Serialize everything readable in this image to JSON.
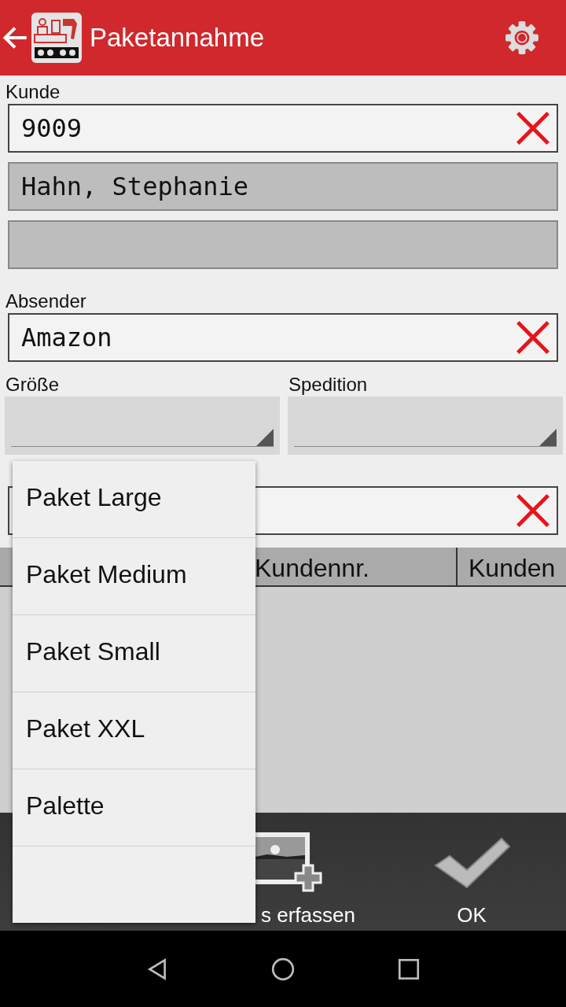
{
  "app_bar": {
    "title": "Paketannahme"
  },
  "customer": {
    "label": "Kunde",
    "number": "9009",
    "name": "Hahn, Stephanie"
  },
  "sender": {
    "label": "Absender",
    "value": "Amazon"
  },
  "size": {
    "label": "Größe"
  },
  "carrier": {
    "label": "Spedition"
  },
  "table": {
    "columns": [
      "",
      "Kundennr.",
      "Kunden"
    ]
  },
  "actions": [
    {
      "label": "s erfassen",
      "kind": "photos"
    },
    {
      "label": "OK",
      "kind": "ok"
    }
  ],
  "dropdown": {
    "items": [
      {
        "label": "Paket Large",
        "selected": false
      },
      {
        "label": "Paket Medium",
        "selected": false
      },
      {
        "label": "Paket Small",
        "selected": false
      },
      {
        "label": "Paket XXL",
        "selected": false
      },
      {
        "label": "Palette",
        "selected": false
      }
    ]
  }
}
